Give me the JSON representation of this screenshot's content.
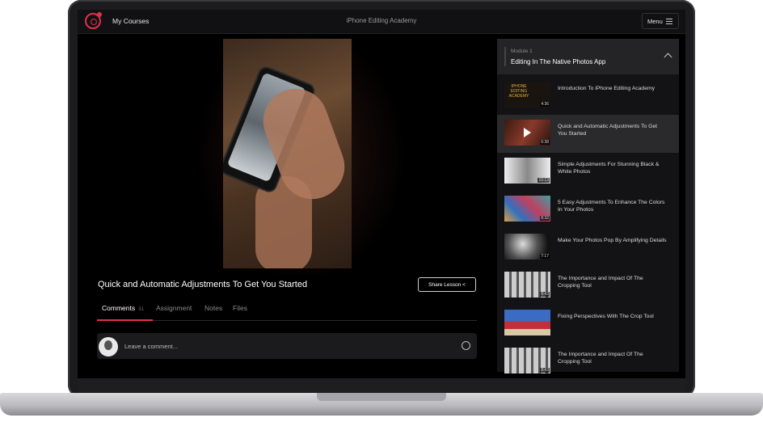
{
  "topbar": {
    "nav_label": "My Courses",
    "app_title": "iPhone Editing Academy",
    "menu_label": "Menu"
  },
  "main": {
    "lesson_title": "Quick and Automatic Adjustments To Get You Started",
    "share_label": "Share Lesson",
    "tabs": [
      {
        "label": "Comments",
        "count": "31"
      },
      {
        "label": "Assignment"
      },
      {
        "label": "Notes"
      },
      {
        "label": "Files"
      }
    ],
    "comment_placeholder": "Leave a comment..."
  },
  "sidebar": {
    "module_number": "Module 1",
    "module_title": "Editing In The Native Photos App",
    "lessons": [
      {
        "title": "Introduction To iPhone Editing Academy",
        "duration": "4:36",
        "thumb_text": "IPHONE EDITING ACADEMY"
      },
      {
        "title": "Quick and Automatic Adjustments To Get You Started",
        "duration": "6:38",
        "active": true
      },
      {
        "title": "Simple Adjustments For Stunning Black & White Photos",
        "duration": "10:13"
      },
      {
        "title": "5 Easy Adjustments To Enhance The Colors In Your Photos",
        "duration": "8:32"
      },
      {
        "title": "Make Your Photos Pop By Amplifying Details",
        "duration": "7:17"
      },
      {
        "title": "The Importance and Impact Of The Cropping Tool",
        "duration": "8:43"
      },
      {
        "title": "Fixing Perspectives With The Crop Tool",
        "duration": ""
      },
      {
        "title": "The Importance and Impact Of The Cropping Tool",
        "duration": "8:43"
      }
    ]
  },
  "colors": {
    "accent": "#e0314b",
    "background": "#000000",
    "panel": "#131315"
  }
}
